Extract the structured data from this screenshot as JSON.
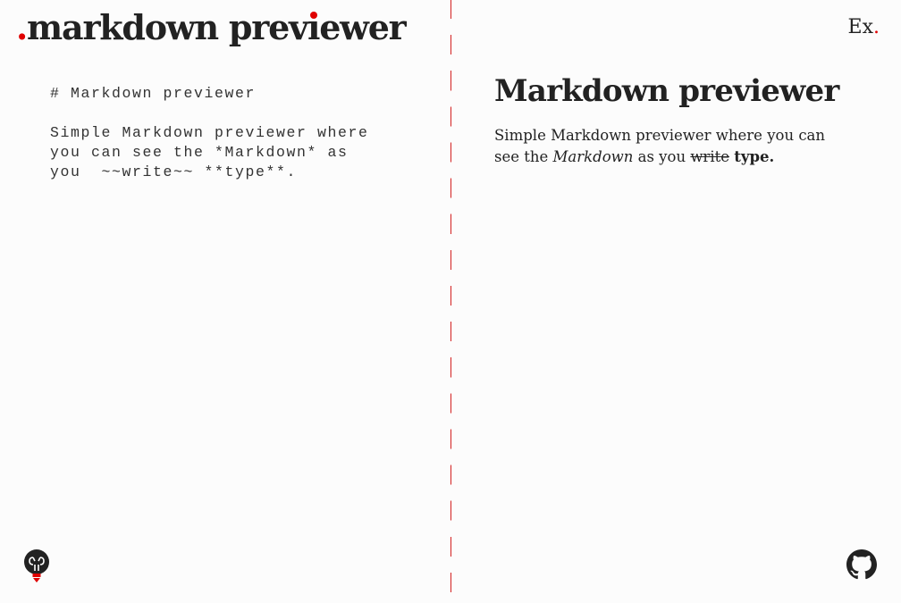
{
  "header": {
    "logo_dot": ".",
    "logo_text_before": "markdown prev",
    "logo_text_i": "ı",
    "logo_text_after": "ewer",
    "example_label": "Ex",
    "example_dot": "."
  },
  "editor": {
    "value": "# Markdown previewer\n\nSimple Markdown previewer where\nyou can see the *Markdown* as\nyou  ~~write~~ **type**."
  },
  "preview": {
    "heading": "Markdown previewer",
    "para_1": "Simple Markdown previewer where you can see the ",
    "para_em": "Markdown",
    "para_2": " as you ",
    "para_del": "write",
    "para_3": " ",
    "para_strong": "type.",
    "para_4": ""
  },
  "icons": {
    "bulb": "lightbulb-icon",
    "github": "github-icon"
  },
  "colors": {
    "accent": "#e00000",
    "text": "#222222",
    "background": "#fcfcfc",
    "divider": "#d32020"
  }
}
